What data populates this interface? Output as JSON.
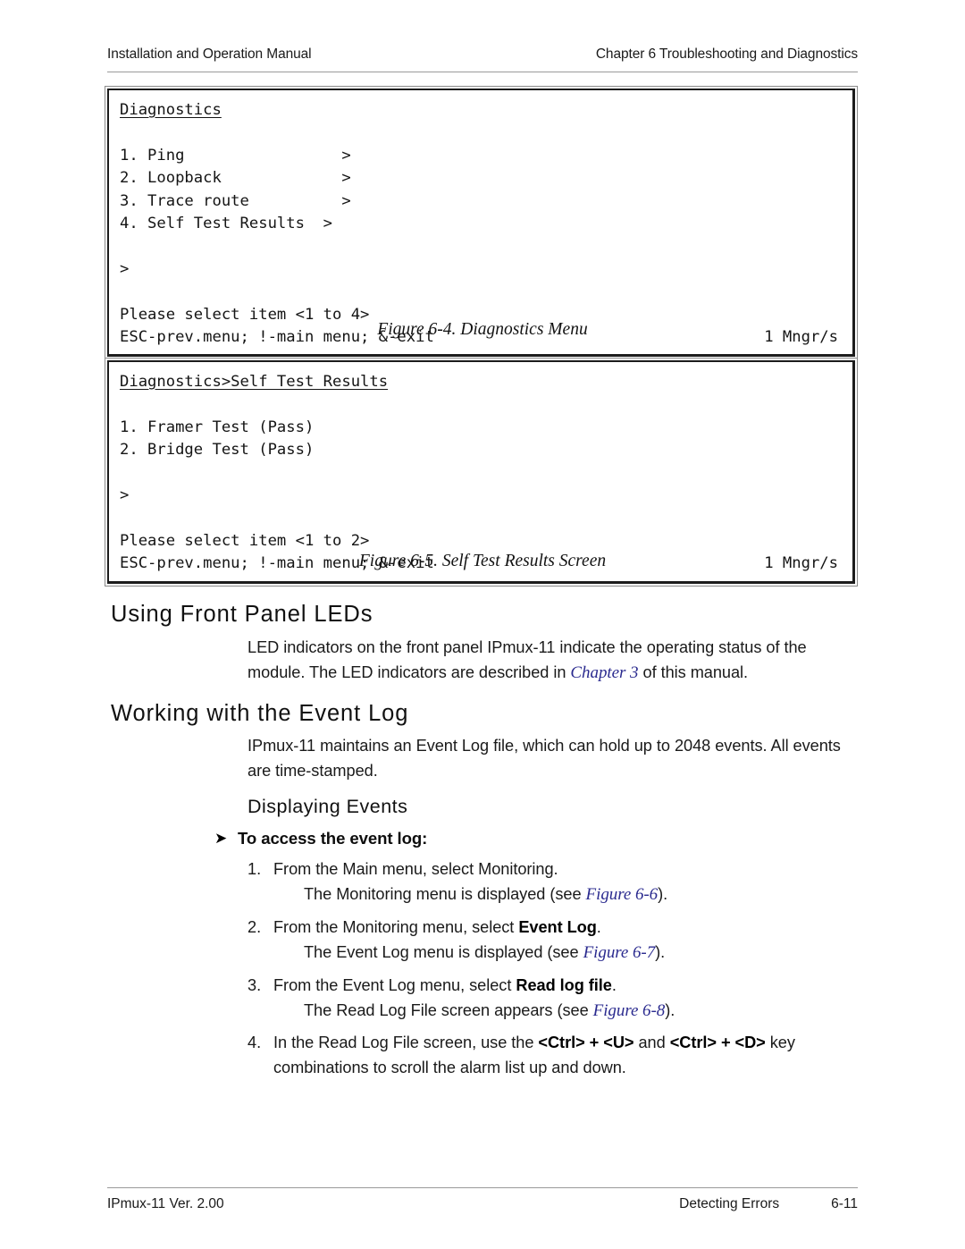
{
  "header": {
    "left": "Installation and Operation Manual",
    "right": "Chapter 6  Troubleshooting and Diagnostics"
  },
  "terminal_diagnostics": {
    "title": "Diagnostics",
    "lines": [
      "1. Ping                 >",
      "2. Loopback             >",
      "3. Trace route          >",
      "4. Self Test Results  >"
    ],
    "prompt": ">",
    "select_prompt": "Please select item <1 to 4>",
    "status_left": "ESC-prev.menu; !-main menu; &-exit",
    "status_right": "1 Mngr/s"
  },
  "caption_figure_6_4": "Figure 6-4.  Diagnostics Menu",
  "terminal_selftest": {
    "title": "Diagnostics>Self Test Results",
    "lines": [
      "1. Framer Test (Pass)",
      "2. Bridge Test (Pass)"
    ],
    "prompt": ">",
    "select_prompt": "Please select item <1 to 2>",
    "status_left": "ESC-prev.menu; !-main menu; &-exit",
    "status_right": "1 Mngr/s"
  },
  "caption_figure_6_5": "Figure 6-5.  Self Test Results Screen",
  "section_leds": {
    "heading": "Using Front Panel LEDs",
    "para_part1": "LED indicators on the front panel IPmux-11 indicate the operating status of the module. The LED indicators are described in ",
    "para_xref": "Chapter 3",
    "para_part2": " of this manual."
  },
  "section_eventlog": {
    "heading": "Working with the Event Log",
    "para": "IPmux-11 maintains an Event Log file, which can hold up to 2048 events. All events are time-stamped."
  },
  "subsection_displaying": {
    "heading": "Displaying Events",
    "arrow_glyph": "➤",
    "procedure_title": "To access the event log:"
  },
  "steps": [
    {
      "num": "1.",
      "text_part1": "From the Main menu, select Monitoring.",
      "bold": "",
      "text_part2": "",
      "sub_part1": "The Monitoring menu is displayed (see ",
      "sub_xref": "Figure 6-6",
      "sub_part2": ")."
    },
    {
      "num": "2.",
      "text_part1": "From the Monitoring menu, select ",
      "bold": "Event Log",
      "text_part2": ".",
      "sub_part1": "The Event Log menu is displayed (see ",
      "sub_xref": "Figure 6-7",
      "sub_part2": ")."
    },
    {
      "num": "3.",
      "text_part1": "From the Event Log menu, select ",
      "bold": "Read log file",
      "text_part2": ".",
      "sub_part1": "The Read Log File screen appears (see ",
      "sub_xref": "Figure 6-8",
      "sub_part2": ")."
    },
    {
      "num": "4.",
      "text_part1": "In the Read Log File screen, use the ",
      "bold": "<Ctrl> + <U>",
      "text_mid": " and ",
      "bold2": "<Ctrl> + <D>",
      "text_part2": " key combinations to scroll the alarm list up and down.",
      "sub_part1": "",
      "sub_xref": "",
      "sub_part2": ""
    }
  ],
  "footer": {
    "left": "IPmux-11 Ver. 2.00",
    "center": "Detecting Errors",
    "right": "6-11"
  },
  "colors": {
    "xref_blue": "#2b2b8f",
    "rule_gray": "#9a9a9a",
    "terminal_border": "#1c1c1c"
  }
}
